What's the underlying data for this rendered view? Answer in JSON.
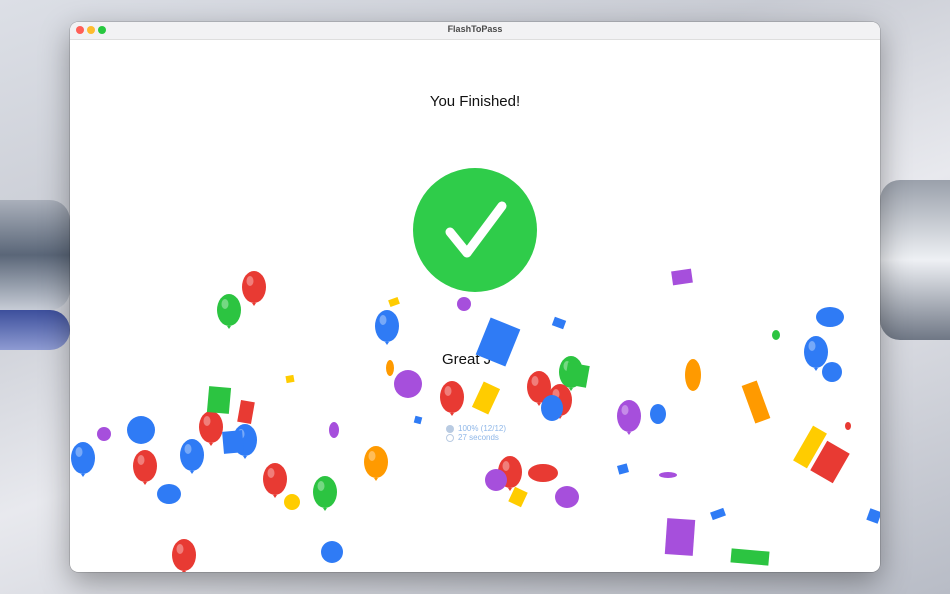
{
  "window": {
    "title": "FlashToPass"
  },
  "traffic_lights": {
    "close": "#ff5f57",
    "minimize": "#febc2e",
    "zoom": "#28c840"
  },
  "result": {
    "heading": "You Finished!",
    "icon": "checkmark-icon",
    "accent_color": "#2fcc4a",
    "message": "Great J",
    "score_text": "100% (12/12)",
    "time_text": "27 seconds"
  },
  "celebration": {
    "type": "balloons-and-confetti",
    "colors": [
      "#e83a33",
      "#2f7bf5",
      "#2cc441",
      "#ff9a00",
      "#a64fdc",
      "#ffcc00"
    ]
  }
}
